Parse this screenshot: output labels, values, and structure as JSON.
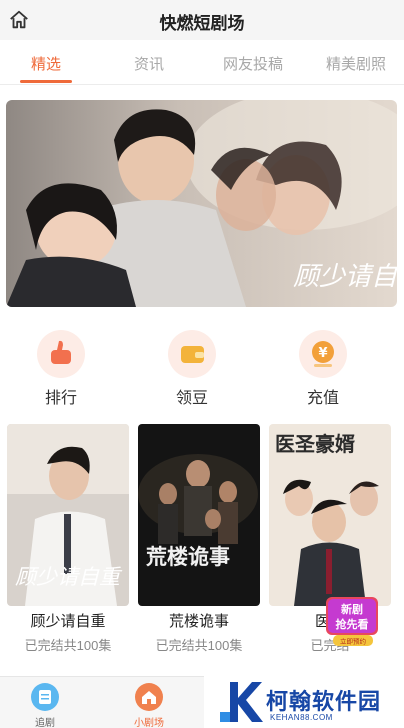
{
  "header": {
    "title": "快燃短剧场",
    "home_icon": "home-icon"
  },
  "tabs": [
    {
      "label": "精选",
      "active": true
    },
    {
      "label": "资讯",
      "active": false
    },
    {
      "label": "网友投稿",
      "active": false
    },
    {
      "label": "精美剧照",
      "active": false
    }
  ],
  "banner": {
    "overlay_title": "顾少请自重"
  },
  "quick_actions": [
    {
      "label": "排行",
      "icon": "thumbs-up-icon"
    },
    {
      "label": "领豆",
      "icon": "wallet-icon"
    },
    {
      "label": "充值",
      "icon": "yen-coin-icon"
    }
  ],
  "dramas": [
    {
      "title": "顾少请自重",
      "status": "已完结共100集",
      "poster_title": "顾少请自重"
    },
    {
      "title": "荒楼诡事",
      "status": "已完结共100集",
      "poster_title": "荒楼诡事"
    },
    {
      "title": "医圣",
      "status": "已完结",
      "poster_title": "医圣豪婿"
    }
  ],
  "promo_badge": {
    "line1": "新剧",
    "line2": "抢先看",
    "line3": "立即预约"
  },
  "bottom_nav": [
    {
      "label": "追剧",
      "icon": "bookshelf-icon",
      "active": false
    },
    {
      "label": "小剧场",
      "icon": "home-icon",
      "active": true
    }
  ],
  "watermark": {
    "brand": "柯翰软件园",
    "site": "KEHAN88.COM",
    "logo_letter": "K"
  },
  "colors": {
    "accent": "#ef6a3a",
    "watermark": "#1747a6"
  }
}
